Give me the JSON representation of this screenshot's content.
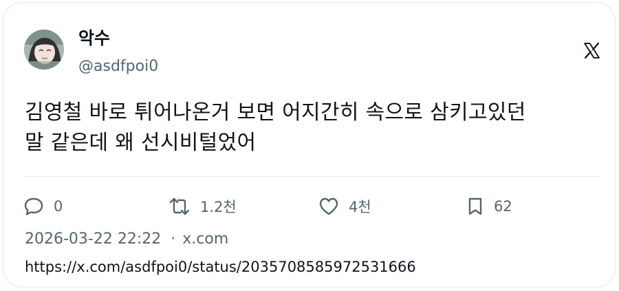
{
  "author": {
    "display_name": "악수",
    "handle": "@asdfpoi0"
  },
  "tweet": {
    "text_line1": "김영철 바로 튀어나온거 보면 어지간히 속으로 삼키고있던",
    "text_line2": "말 같은데 왜 선시비털었어"
  },
  "actions": {
    "reply": {
      "icon": "reply-icon",
      "count": "0"
    },
    "retweet": {
      "icon": "retweet-icon",
      "count": "1.2천"
    },
    "like": {
      "icon": "heart-icon",
      "count": "4천"
    },
    "bookmark": {
      "icon": "bookmark-icon",
      "count": "62"
    }
  },
  "meta": {
    "timestamp": "2026-03-22 22:22",
    "separator": "·",
    "source": "x.com"
  },
  "link": {
    "url": "https://x.com/asdfpoi0/status/2035708585972531666"
  },
  "brand": {
    "logo_icon": "x-logo-icon"
  },
  "colors": {
    "text_primary": "#0f1419",
    "text_secondary": "#536471",
    "border": "#e1e8ed"
  }
}
